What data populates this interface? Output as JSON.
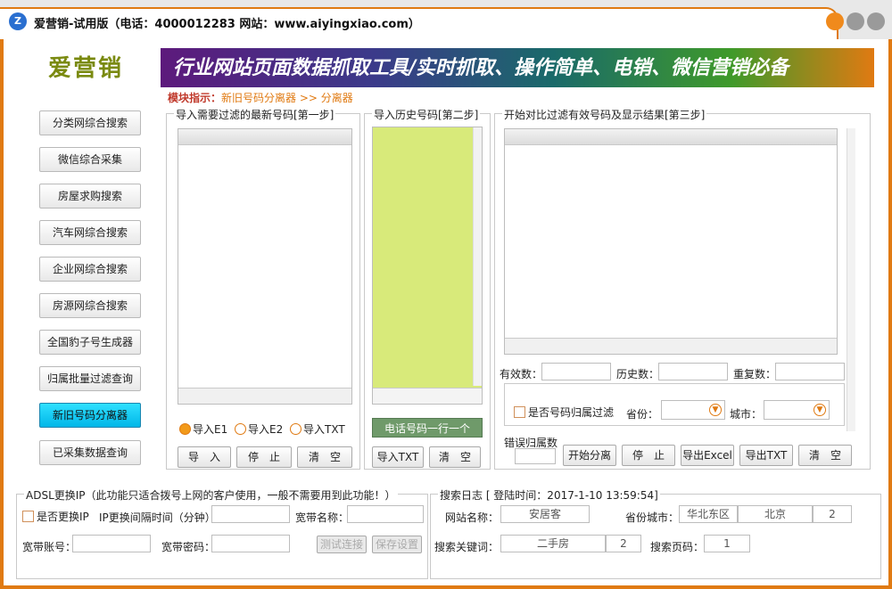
{
  "window": {
    "title": "爱营销-试用版（电话：4000012283   网站：www.aiyingxiao.com）",
    "logo_glyph": "Z"
  },
  "brand": "爱营销",
  "banner": "行业网站页面数据抓取工具/实时抓取、操作简单、电销、微信营销必备",
  "hint": {
    "label": "模块指示：",
    "path": "新旧号码分离器 >> 分离器"
  },
  "nav": [
    {
      "label": "分类网综合搜索"
    },
    {
      "label": "微信综合采集"
    },
    {
      "label": "房屋求购搜索"
    },
    {
      "label": "汽车网综合搜索"
    },
    {
      "label": "企业网综合搜索"
    },
    {
      "label": "房源网综合搜索"
    },
    {
      "label": "全国豹子号生成器"
    },
    {
      "label": "归属批量过滤查询"
    },
    {
      "label": "新旧号码分离器"
    },
    {
      "label": "已采集数据查询"
    }
  ],
  "step1": {
    "legend": "导入需要过滤的最新号码[第一步]",
    "radios": [
      "导入E1",
      "导入E2",
      "导入TXT"
    ],
    "btn_import": "导　入",
    "btn_stop": "停　止",
    "btn_clear": "清　空"
  },
  "step2": {
    "legend": "导入历史号码[第二步]",
    "note": "电话号码一行一个",
    "btn_import": "导入TXT",
    "btn_clear": "清　空"
  },
  "step3": {
    "legend": "开始对比过滤有效号码及显示结果[第三步]",
    "valid_label": "有效数：",
    "history_label": "历史数：",
    "dup_label": "重复数：",
    "filter_check": "是否号码归属过滤",
    "province_label": "省份：",
    "city_label": "城市：",
    "error_label": "错误归属数",
    "btn_start": "开始分离",
    "btn_stop": "停　止",
    "btn_excel": "导出Excel",
    "btn_txt": "导出TXT",
    "btn_clear": "清　空"
  },
  "adsl": {
    "legend": "ADSL更换IP（此功能只适合拨号上网的客户使用，一般不需要用到此功能！）",
    "check": "是否更换IP",
    "interval_label": "IP更换间隔时间（分钟）",
    "account_label": "宽带名称：",
    "user_label": "宽带账号：",
    "pwd_label": "宽带密码：",
    "btn_test": "测试连接",
    "btn_save": "保存设置"
  },
  "log": {
    "legend": "搜索日志 [ 登陆时间：2017-1-10 13:59:54]",
    "site_label": "网站名称：",
    "site_value": "安居客",
    "region_label": "省份城市：",
    "region_value": "华北东区",
    "city_value": "北京",
    "city_count": "2",
    "keyword_label": "搜索关键词：",
    "keyword_value": "二手房",
    "keyword_count": "2",
    "page_label": "搜索页码：",
    "page_value": "1"
  }
}
